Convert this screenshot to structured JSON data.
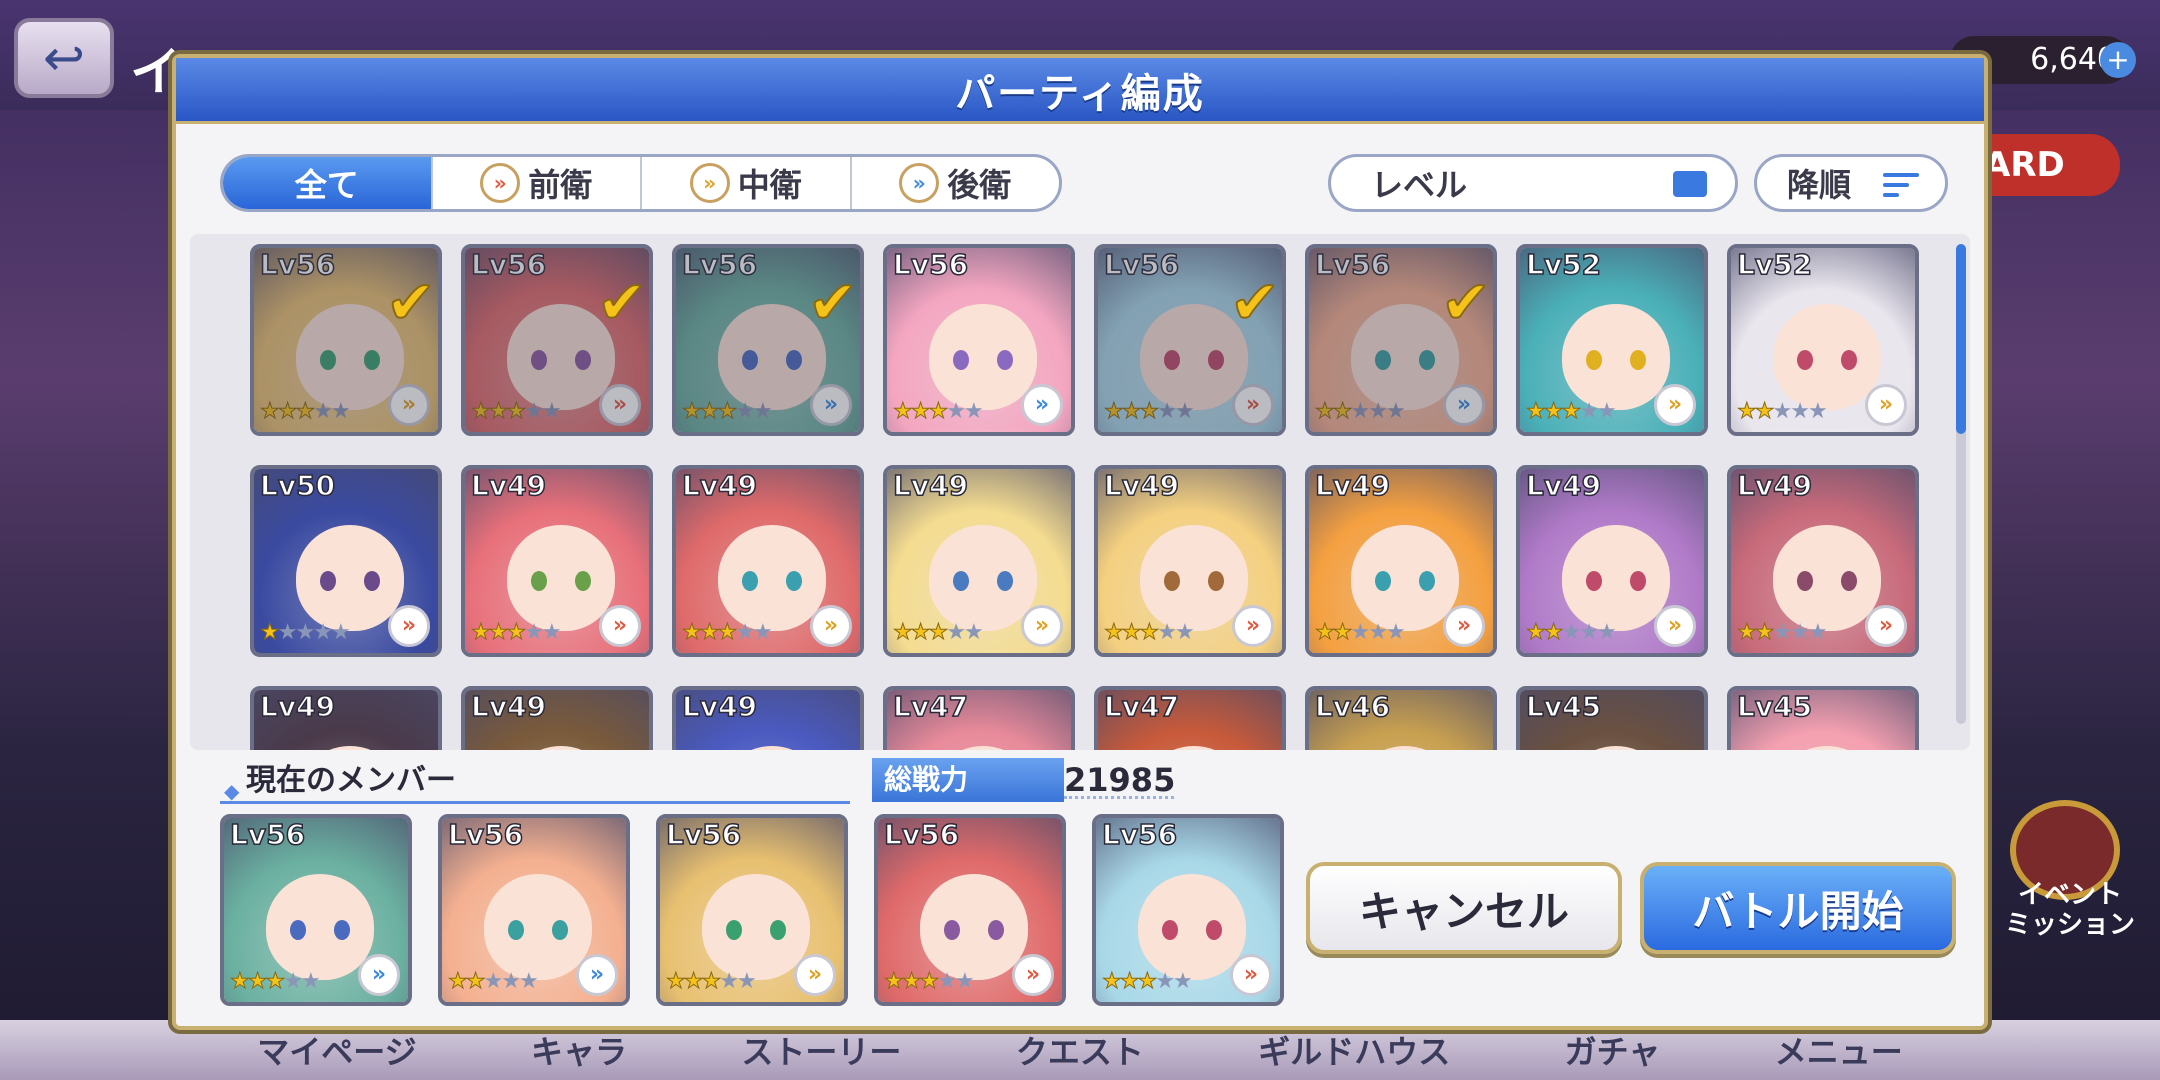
{
  "background": {
    "title": "イ",
    "jewels": "6,640",
    "card_tag": "ARD",
    "event_button": "イベント\nミッション",
    "bottom_nav": [
      "マイページ",
      "キャラ",
      "ストーリー",
      "クエスト",
      "ギルドハウス",
      "ガチャ",
      "メニュー"
    ]
  },
  "modal": {
    "title": "パーティ編成",
    "filter_tabs": [
      {
        "label": "全て",
        "active": true,
        "icon": ""
      },
      {
        "label": "前衛",
        "active": false,
        "icon": "front-position-icon"
      },
      {
        "label": "中衛",
        "active": false,
        "icon": "middle-position-icon"
      },
      {
        "label": "後衛",
        "active": false,
        "icon": "back-position-icon"
      }
    ],
    "sort_select": "レベル",
    "order_button": "降順",
    "roster": [
      {
        "level": "Lv56",
        "stars": 3,
        "role": "mid",
        "selected": true,
        "hair": "#e8c070",
        "eyes": "#3aa070"
      },
      {
        "level": "Lv56",
        "stars": 3,
        "role": "front",
        "selected": true,
        "hair": "#e06a6a",
        "eyes": "#8a5aa0"
      },
      {
        "level": "Lv56",
        "stars": 3,
        "role": "back",
        "selected": true,
        "hair": "#6ab0a0",
        "eyes": "#4a6ac0"
      },
      {
        "level": "Lv56",
        "stars": 3,
        "role": "back",
        "selected": false,
        "hair": "#f4a6c0",
        "eyes": "#8a6ac0"
      },
      {
        "level": "Lv56",
        "stars": 3,
        "role": "front",
        "selected": true,
        "hair": "#a8d8e8",
        "eyes": "#c04a6a"
      },
      {
        "level": "Lv56",
        "stars": 2,
        "role": "back",
        "selected": true,
        "hair": "#f4b090",
        "eyes": "#3aa0a0"
      },
      {
        "level": "Lv52",
        "stars": 3,
        "role": "mid",
        "selected": false,
        "hair": "#4ab0b8",
        "eyes": "#e0b020"
      },
      {
        "level": "Lv52",
        "stars": 2,
        "role": "mid",
        "selected": false,
        "hair": "#eae6ee",
        "eyes": "#c04a6a"
      },
      {
        "level": "Lv50",
        "stars": 1,
        "role": "front",
        "selected": false,
        "hair": "#3a4aa0",
        "eyes": "#6a4a8a"
      },
      {
        "level": "Lv49",
        "stars": 3,
        "role": "front",
        "selected": false,
        "hair": "#e8707a",
        "eyes": "#6aa04a"
      },
      {
        "level": "Lv49",
        "stars": 3,
        "role": "mid",
        "selected": false,
        "hair": "#e06a6a",
        "eyes": "#3aa0b0"
      },
      {
        "level": "Lv49",
        "stars": 3,
        "role": "mid",
        "selected": false,
        "hair": "#f4dc90",
        "eyes": "#4a7ac0"
      },
      {
        "level": "Lv49",
        "stars": 3,
        "role": "front",
        "selected": false,
        "hair": "#f4d080",
        "eyes": "#a06a3a"
      },
      {
        "level": "Lv49",
        "stars": 2,
        "role": "front",
        "selected": false,
        "hair": "#f4a040",
        "eyes": "#3aa0b0"
      },
      {
        "level": "Lv49",
        "stars": 2,
        "role": "mid",
        "selected": false,
        "hair": "#b07ac8",
        "eyes": "#c04a6a"
      },
      {
        "level": "Lv49",
        "stars": 2,
        "role": "front",
        "selected": false,
        "hair": "#c86a7a",
        "eyes": "#8a4a6a"
      },
      {
        "level": "Lv49",
        "stars": 0,
        "role": "",
        "selected": false,
        "hair": "#4a3a4a",
        "eyes": "#6a4a8a"
      },
      {
        "level": "Lv49",
        "stars": 0,
        "role": "",
        "selected": false,
        "hair": "#7a5a3a",
        "eyes": "#6a4a8a"
      },
      {
        "level": "Lv49",
        "stars": 0,
        "role": "",
        "selected": false,
        "hair": "#4a5ac0",
        "eyes": "#6a4a8a"
      },
      {
        "level": "Lv47",
        "stars": 0,
        "role": "",
        "selected": false,
        "hair": "#e88a9a",
        "eyes": "#6a4a8a"
      },
      {
        "level": "Lv47",
        "stars": 0,
        "role": "",
        "selected": false,
        "hair": "#c85a3a",
        "eyes": "#6a4a8a"
      },
      {
        "level": "Lv46",
        "stars": 0,
        "role": "",
        "selected": false,
        "hair": "#c8a050",
        "eyes": "#6a4a8a"
      },
      {
        "level": "Lv45",
        "stars": 0,
        "role": "",
        "selected": false,
        "hair": "#6a5040",
        "eyes": "#6a4a8a"
      },
      {
        "level": "Lv45",
        "stars": 0,
        "role": "",
        "selected": false,
        "hair": "#f4a0b0",
        "eyes": "#6a4a8a"
      }
    ],
    "members_label": "現在のメンバー",
    "power_label": "総戦力",
    "power_value": "21985",
    "members": [
      {
        "level": "Lv56",
        "stars": 3,
        "role": "back",
        "hair": "#6ab0a0",
        "eyes": "#4a6ac0"
      },
      {
        "level": "Lv56",
        "stars": 2,
        "role": "back",
        "hair": "#f4b090",
        "eyes": "#3aa0a0"
      },
      {
        "level": "Lv56",
        "stars": 3,
        "role": "mid",
        "hair": "#e8c070",
        "eyes": "#3aa070"
      },
      {
        "level": "Lv56",
        "stars": 3,
        "role": "front",
        "hair": "#e06a6a",
        "eyes": "#8a5aa0"
      },
      {
        "level": "Lv56",
        "stars": 3,
        "role": "front",
        "hair": "#a8d8e8",
        "eyes": "#c04a6a"
      }
    ],
    "cancel_button": "キャンセル",
    "battle_button": "バトル開始"
  }
}
